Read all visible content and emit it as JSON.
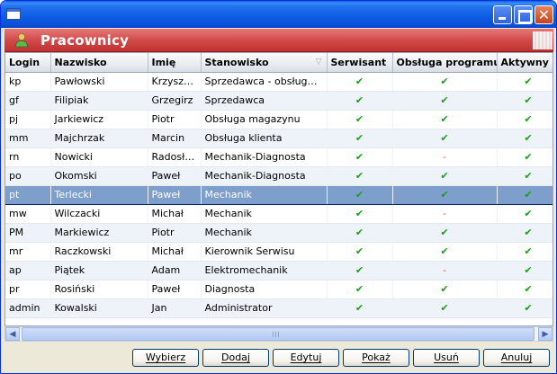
{
  "window": {
    "close_glyph": "✕"
  },
  "header": {
    "title": "Pracownicy"
  },
  "table": {
    "columns": [
      "Login",
      "Nazwisko",
      "Imię",
      "Stanowisko",
      "Serwisant",
      "Obsługa programu",
      "Aktywny"
    ],
    "rows": [
      {
        "login": "kp",
        "nazwisko": "Pawłowski",
        "imie": "Krzysztof",
        "stanowisko": "Sprzedawca - obsługa m…",
        "serwisant": "✔",
        "obsluga": "✔",
        "aktywny": "✔"
      },
      {
        "login": "gf",
        "nazwisko": "Filipiak",
        "imie": "Grzegirz",
        "stanowisko": "Sprzedawca",
        "serwisant": "✔",
        "obsluga": "✔",
        "aktywny": "✔"
      },
      {
        "login": "pj",
        "nazwisko": "Jarkiewicz",
        "imie": "Piotr",
        "stanowisko": "Obsługa magazynu",
        "serwisant": "✔",
        "obsluga": "✔",
        "aktywny": "✔"
      },
      {
        "login": "mm",
        "nazwisko": "Majchrzak",
        "imie": "Marcin",
        "stanowisko": "Obsługa klienta",
        "serwisant": "✔",
        "obsluga": "✔",
        "aktywny": "✔"
      },
      {
        "login": "rn",
        "nazwisko": "Nowicki",
        "imie": "Radosław",
        "stanowisko": "Mechanik-Diagnosta",
        "serwisant": "✔",
        "obsluga": "-",
        "aktywny": "✔"
      },
      {
        "login": "po",
        "nazwisko": "Okomski",
        "imie": "Paweł",
        "stanowisko": "Mechanik-Diagnosta",
        "serwisant": "✔",
        "obsluga": "✔",
        "aktywny": "✔"
      },
      {
        "login": "pt",
        "nazwisko": "Terlecki",
        "imie": "Paweł",
        "stanowisko": "Mechanik",
        "serwisant": "✔",
        "obsluga": "✔",
        "aktywny": "✔"
      },
      {
        "login": "mw",
        "nazwisko": "Wilczacki",
        "imie": "Michał",
        "stanowisko": "Mechanik",
        "serwisant": "✔",
        "obsluga": "-",
        "aktywny": "✔"
      },
      {
        "login": "PM",
        "nazwisko": "Markiewicz",
        "imie": "Piotr",
        "stanowisko": "Mechanik",
        "serwisant": "✔",
        "obsluga": "✔",
        "aktywny": "✔"
      },
      {
        "login": "mr",
        "nazwisko": "Raczkowski",
        "imie": "Michał",
        "stanowisko": "Kierownik Serwisu",
        "serwisant": "✔",
        "obsluga": "✔",
        "aktywny": "✔"
      },
      {
        "login": "ap",
        "nazwisko": "Piątek",
        "imie": "Adam",
        "stanowisko": "Elektromechanik",
        "serwisant": "✔",
        "obsluga": "-",
        "aktywny": "✔"
      },
      {
        "login": "pr",
        "nazwisko": "Rosiński",
        "imie": "Paweł",
        "stanowisko": "Diagnosta",
        "serwisant": "✔",
        "obsluga": "✔",
        "aktywny": "✔"
      },
      {
        "login": "admin",
        "nazwisko": "Kowalski",
        "imie": "Jan",
        "stanowisko": "Administrator",
        "serwisant": "✔",
        "obsluga": "✔",
        "aktywny": "✔"
      }
    ]
  },
  "scrollbar": {
    "left_arrow": "◀",
    "right_arrow": "▶"
  },
  "buttons": {
    "wybierz": "Wybierz",
    "dodaj": "Dodaj",
    "edytuj": "Edytuj",
    "pokaz": "Pokaż",
    "usun": "Usuń",
    "anuluj": "Anuluj"
  },
  "colors": {
    "header_red": "#D24A4A",
    "selected_row": "#7E9ECB",
    "check_green": "#18A018",
    "dash_red": "#E05050",
    "title_blue": "#0A50D8"
  },
  "icons": {
    "header": "user-icon",
    "sort": "sort-descending-icon"
  }
}
